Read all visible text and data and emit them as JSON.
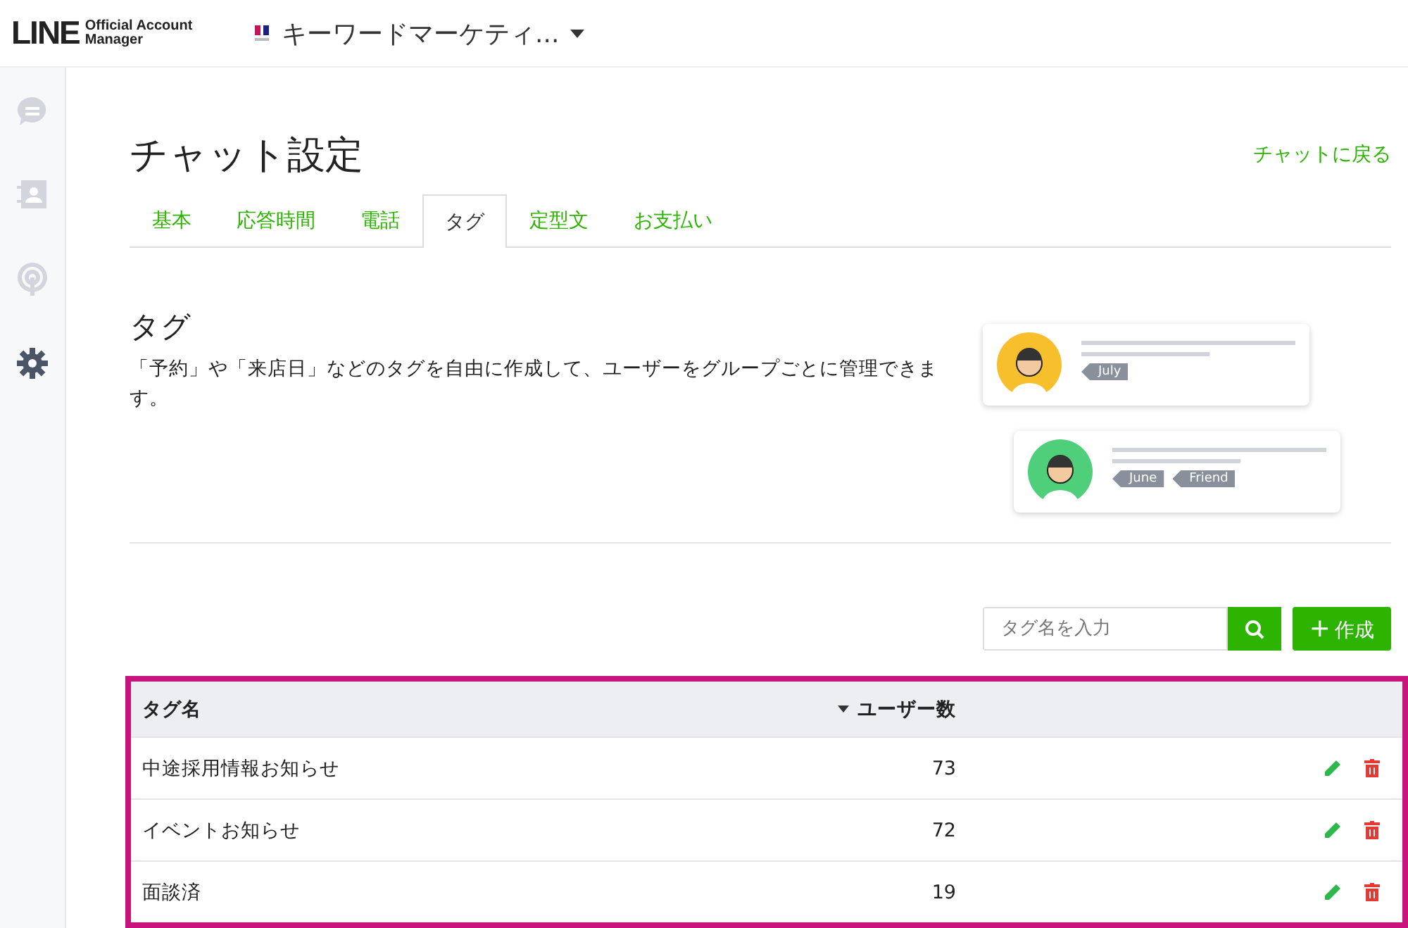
{
  "header": {
    "logo_main": "LINE",
    "logo_sub_1": "Official Account",
    "logo_sub_2": "Manager",
    "account_name": "キーワードマーケティ..."
  },
  "sidebar": {
    "items": [
      {
        "kind": "chat",
        "selected": false
      },
      {
        "kind": "contacts",
        "selected": false
      },
      {
        "kind": "broadcast",
        "selected": false
      },
      {
        "kind": "settings",
        "selected": true
      }
    ]
  },
  "page": {
    "title": "チャット設定",
    "back_link": "チャットに戻る"
  },
  "tabs": [
    {
      "label": "基本",
      "selected": false
    },
    {
      "label": "応答時間",
      "selected": false
    },
    {
      "label": "電話",
      "selected": false
    },
    {
      "label": "タグ",
      "selected": true
    },
    {
      "label": "定型文",
      "selected": false
    },
    {
      "label": "お支払い",
      "selected": false
    }
  ],
  "section": {
    "title": "タグ",
    "description": "「予約」や「来店日」などのタグを自由に作成して、ユーザーをグループごとに管理できます。",
    "illustration_cards": [
      {
        "color": "#f8bf2c",
        "tags": [
          "July"
        ]
      },
      {
        "color": "#4fcf79",
        "tags": [
          "June",
          "Friend"
        ]
      }
    ]
  },
  "search": {
    "placeholder": "タグ名を入力"
  },
  "create_button": {
    "icon": "+",
    "label": "作成"
  },
  "table": {
    "columns": [
      "タグ名",
      "ユーザー数"
    ],
    "rows": [
      {
        "name": "中途採用情報お知らせ",
        "count": "73"
      },
      {
        "name": "イベントお知らせ",
        "count": "72"
      },
      {
        "name": "面談済",
        "count": "19"
      }
    ]
  }
}
